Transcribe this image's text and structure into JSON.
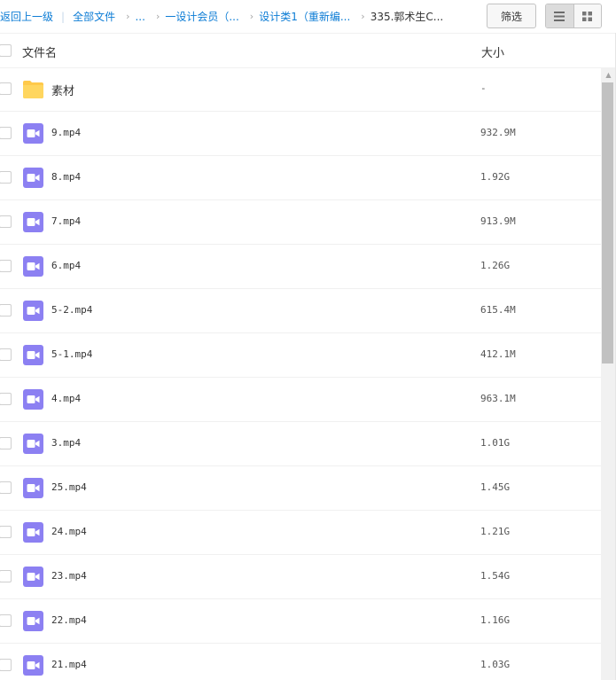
{
  "breadcrumb": {
    "back": "返回上一级",
    "items": [
      "全部文件",
      "...",
      "一设计会员（...",
      "设计类1（重新编...",
      "335.郭术生C..."
    ]
  },
  "toolbar": {
    "filter_label": "筛选",
    "view_mode": "list"
  },
  "columns": {
    "name": "文件名",
    "size": "大小"
  },
  "files": [
    {
      "name": "素材",
      "size": "-",
      "type": "folder"
    },
    {
      "name": "9.mp4",
      "size": "932.9M",
      "type": "video"
    },
    {
      "name": "8.mp4",
      "size": "1.92G",
      "type": "video"
    },
    {
      "name": "7.mp4",
      "size": "913.9M",
      "type": "video"
    },
    {
      "name": "6.mp4",
      "size": "1.26G",
      "type": "video"
    },
    {
      "name": "5-2.mp4",
      "size": "615.4M",
      "type": "video"
    },
    {
      "name": "5-1.mp4",
      "size": "412.1M",
      "type": "video"
    },
    {
      "name": "4.mp4",
      "size": "963.1M",
      "type": "video"
    },
    {
      "name": "3.mp4",
      "size": "1.01G",
      "type": "video"
    },
    {
      "name": "25.mp4",
      "size": "1.45G",
      "type": "video"
    },
    {
      "name": "24.mp4",
      "size": "1.21G",
      "type": "video"
    },
    {
      "name": "23.mp4",
      "size": "1.54G",
      "type": "video"
    },
    {
      "name": "22.mp4",
      "size": "1.16G",
      "type": "video"
    },
    {
      "name": "21.mp4",
      "size": "1.03G",
      "type": "video"
    }
  ],
  "colors": {
    "link": "#0c7cd5",
    "folder": "#ffd35a",
    "video": "#8a7cf0"
  }
}
